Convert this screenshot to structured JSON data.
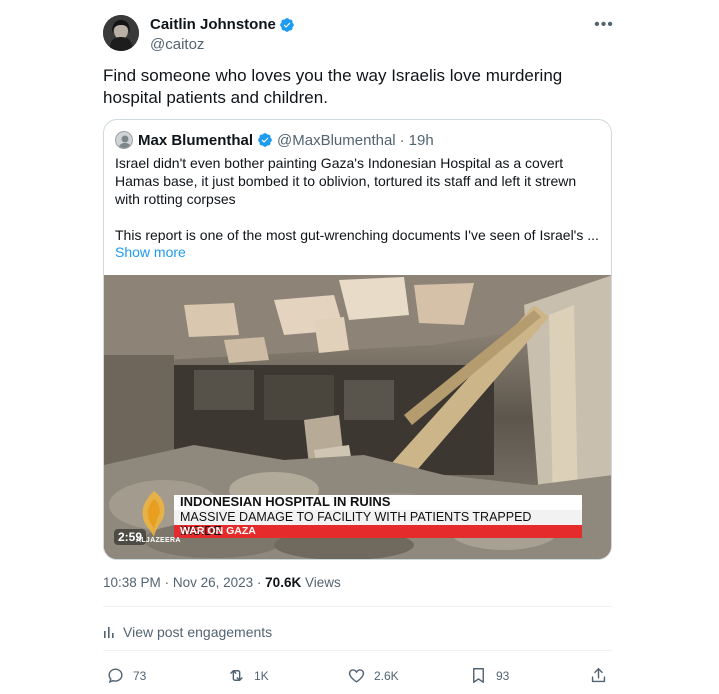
{
  "author": {
    "name": "Caitlin Johnstone",
    "handle": "@caitoz"
  },
  "tweet": {
    "text": "Find someone who loves you the way Israelis love murdering hospital patients and children."
  },
  "quote": {
    "name": "Max Blumenthal",
    "handle": "@MaxBlumenthal",
    "separator": "·",
    "time": "19h",
    "paragraph1": "Israel didn't even bother painting Gaza's Indonesian Hospital as a covert Hamas base, it just bombed it to oblivion, tortured its staff and left it strewn with rotting corpses",
    "paragraph2": "This report is one of the most gut-wrenching documents I've seen of Israel's ...",
    "show_more": "Show more",
    "video": {
      "headline": "INDONESIAN HOSPITAL IN RUINS",
      "subheadline": "MASSIVE DAMAGE TO FACILITY WITH PATIENTS TRAPPED INSIDE",
      "tag": "WAR ON GAZA",
      "duration": "2:59",
      "channel": "ALJAZEERA"
    }
  },
  "meta": {
    "time": "10:38 PM",
    "date": "Nov 26, 2023",
    "views_count": "70.6K",
    "views_label": "Views",
    "separator": "·"
  },
  "engagements_label": "View post engagements",
  "actions": {
    "replies": "73",
    "reposts": "1K",
    "likes": "2.6K",
    "bookmarks": "93"
  },
  "colors": {
    "accent": "#1d9bf0",
    "text": "#0f1419",
    "secondary": "#536471",
    "border": "#cfd9de",
    "news_red": "#e52b2b"
  },
  "icons": [
    "verified-badge-icon",
    "more-icon",
    "bar-chart-icon",
    "reply-icon",
    "repost-icon",
    "like-icon",
    "bookmark-icon",
    "share-icon"
  ]
}
